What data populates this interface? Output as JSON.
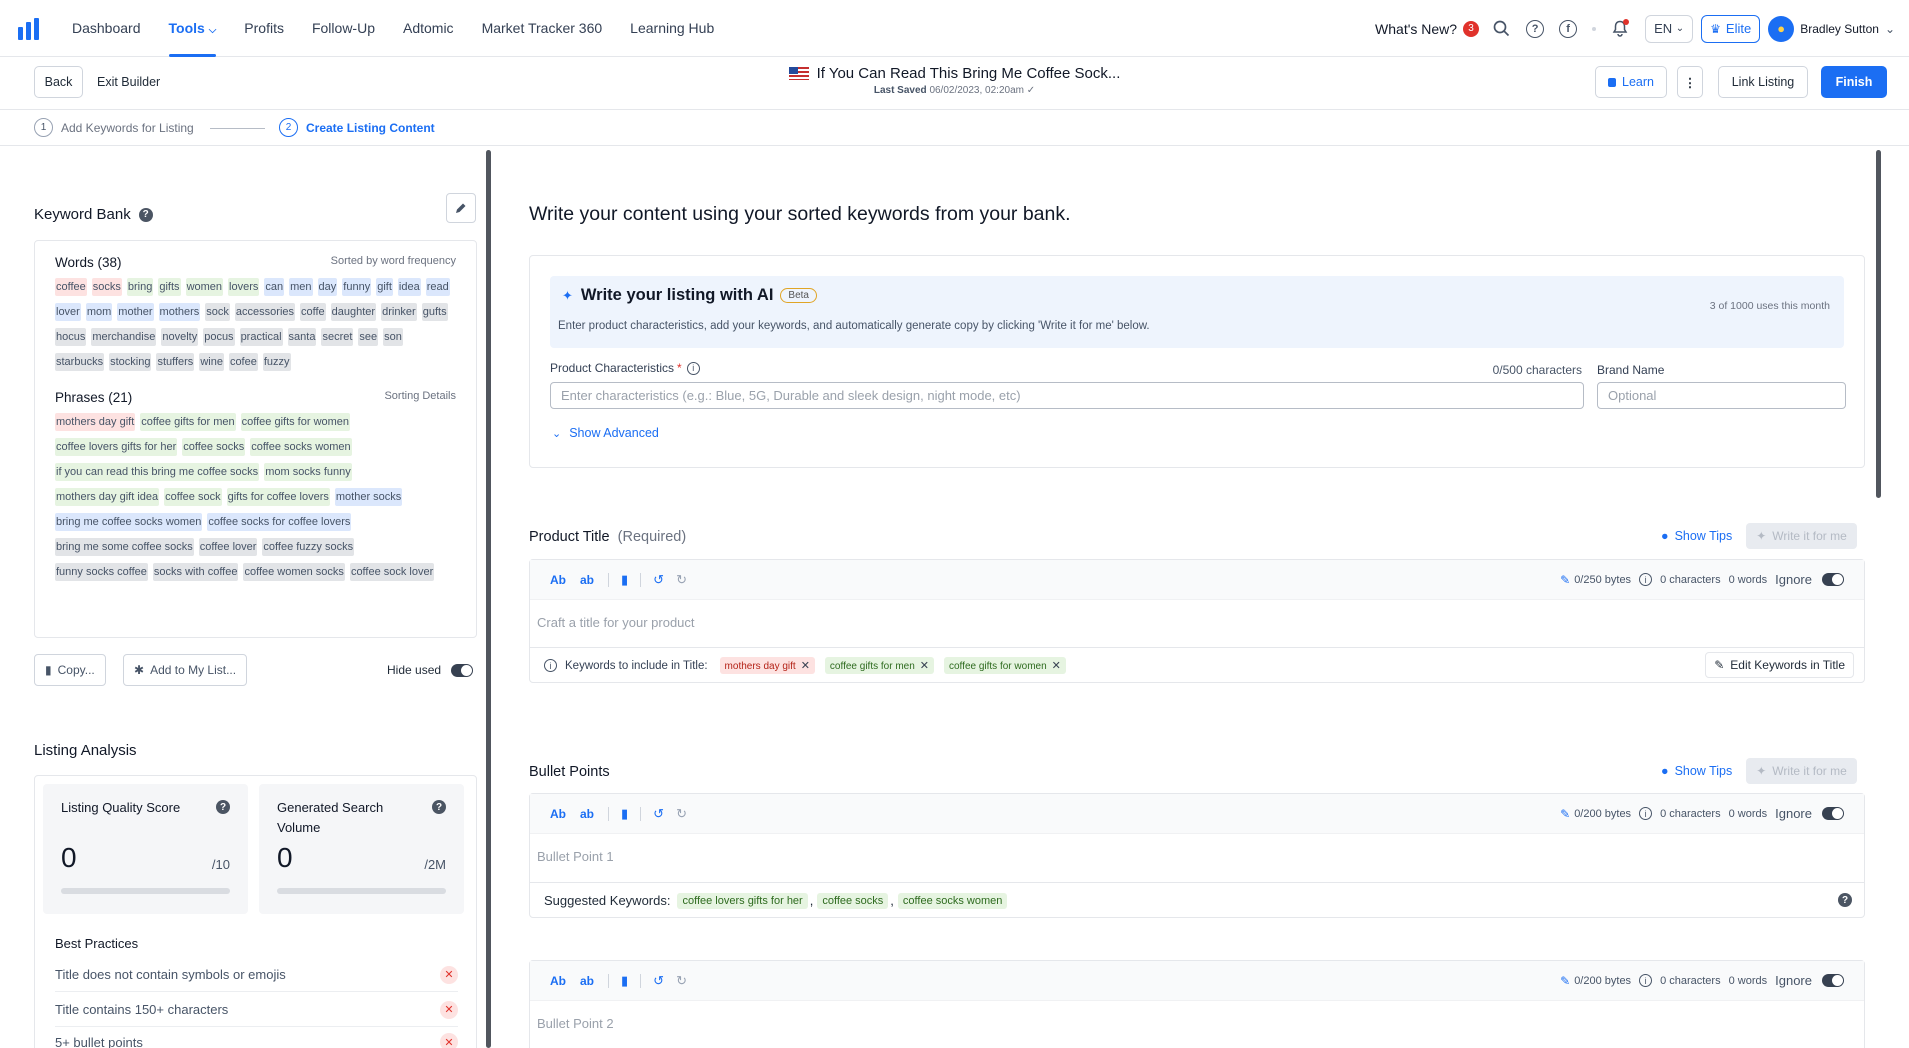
{
  "nav": {
    "items": [
      "Dashboard",
      "Tools",
      "Profits",
      "Follow-Up",
      "Adtomic",
      "Market Tracker 360",
      "Learning Hub"
    ],
    "active": "Tools",
    "whats_new": "What's New?",
    "whats_new_count": "3",
    "language": "EN",
    "plan": "Elite",
    "user": "Bradley Sutton"
  },
  "builder": {
    "back": "Back",
    "exit": "Exit Builder",
    "listing_title": "If You Can Read This Bring Me Coffee Sock...",
    "last_saved_label": "Last Saved",
    "last_saved_value": "06/02/2023, 02:20am",
    "learn": "Learn",
    "link_listing": "Link Listing",
    "finish": "Finish"
  },
  "steps": [
    {
      "num": "1",
      "label": "Add Keywords for Listing"
    },
    {
      "num": "2",
      "label": "Create Listing Content"
    }
  ],
  "keyword_bank": {
    "title": "Keyword Bank",
    "words_header": "Words (38)",
    "words_sort": "Sorted by word frequency",
    "words": [
      {
        "t": "coffee",
        "c": "red"
      },
      {
        "t": "socks",
        "c": "red"
      },
      {
        "t": "bring",
        "c": "green"
      },
      {
        "t": "gifts",
        "c": "green"
      },
      {
        "t": "women",
        "c": "green"
      },
      {
        "t": "lovers",
        "c": "green"
      },
      {
        "t": "can",
        "c": "blue"
      },
      {
        "t": "men",
        "c": "blue"
      },
      {
        "t": "day",
        "c": "blue"
      },
      {
        "t": "funny",
        "c": "blue"
      },
      {
        "t": "gift",
        "c": "blue"
      },
      {
        "t": "idea",
        "c": "blue"
      },
      {
        "t": "read",
        "c": "blue"
      },
      {
        "t": "lover",
        "c": "blue"
      },
      {
        "t": "mom",
        "c": "blue"
      },
      {
        "t": "mother",
        "c": "blue"
      },
      {
        "t": "mothers",
        "c": "blue"
      },
      {
        "t": "sock",
        "c": "gray"
      },
      {
        "t": "accessories",
        "c": "gray"
      },
      {
        "t": "coffe",
        "c": "gray"
      },
      {
        "t": "daughter",
        "c": "gray"
      },
      {
        "t": "drinker",
        "c": "gray"
      },
      {
        "t": "gufts",
        "c": "gray"
      },
      {
        "t": "hocus",
        "c": "gray"
      },
      {
        "t": "merchandise",
        "c": "gray"
      },
      {
        "t": "novelty",
        "c": "gray"
      },
      {
        "t": "pocus",
        "c": "gray"
      },
      {
        "t": "practical",
        "c": "gray"
      },
      {
        "t": "santa",
        "c": "gray"
      },
      {
        "t": "secret",
        "c": "gray"
      },
      {
        "t": "see",
        "c": "gray"
      },
      {
        "t": "son",
        "c": "gray"
      },
      {
        "t": "starbucks",
        "c": "gray"
      },
      {
        "t": "stocking",
        "c": "gray"
      },
      {
        "t": "stuffers",
        "c": "gray"
      },
      {
        "t": "wine",
        "c": "gray"
      },
      {
        "t": "cofee",
        "c": "gray"
      },
      {
        "t": "fuzzy",
        "c": "gray"
      }
    ],
    "phrases_header": "Phrases (21)",
    "phrases_sort": "Sorting Details",
    "phrases": [
      {
        "t": "mothers day gift",
        "c": "red"
      },
      {
        "t": "coffee gifts for men",
        "c": "green"
      },
      {
        "t": "coffee gifts for women",
        "c": "green"
      },
      {
        "t": "coffee lovers gifts for her",
        "c": "green"
      },
      {
        "t": "coffee socks",
        "c": "green"
      },
      {
        "t": "coffee socks women",
        "c": "green"
      },
      {
        "t": "if you can read this bring me coffee socks",
        "c": "green"
      },
      {
        "t": "mom socks funny",
        "c": "green"
      },
      {
        "t": "mothers day gift idea",
        "c": "green"
      },
      {
        "t": "coffee sock",
        "c": "green"
      },
      {
        "t": "gifts for coffee lovers",
        "c": "green"
      },
      {
        "t": "mother socks",
        "c": "blue"
      },
      {
        "t": "bring me coffee socks women",
        "c": "blue"
      },
      {
        "t": "coffee socks for coffee lovers",
        "c": "blue"
      },
      {
        "t": "bring me some coffee socks",
        "c": "gray"
      },
      {
        "t": "coffee lover",
        "c": "gray"
      },
      {
        "t": "coffee fuzzy socks",
        "c": "gray"
      },
      {
        "t": "funny socks coffee",
        "c": "gray"
      },
      {
        "t": "socks with coffee",
        "c": "gray"
      },
      {
        "t": "coffee women socks",
        "c": "gray"
      },
      {
        "t": "coffee sock lover",
        "c": "gray"
      }
    ],
    "copy": "Copy...",
    "add_to_list": "Add to My List...",
    "hide_used": "Hide used"
  },
  "analysis": {
    "title": "Listing Analysis",
    "quality_label": "Listing Quality Score",
    "quality_value": "0",
    "quality_max": "/10",
    "volume_label": "Generated Search Volume",
    "volume_value": "0",
    "volume_max": "/2M",
    "best_practices": "Best Practices",
    "practices": [
      "Title does not contain symbols or emojis",
      "Title contains 150+ characters",
      "5+ bullet points"
    ]
  },
  "main": {
    "heading": "Write your content using your sorted keywords from your bank.",
    "ai_title": "Write your listing with AI",
    "ai_badge": "Beta",
    "ai_desc": "Enter product characteristics, add your keywords, and automatically generate copy by clicking 'Write it for me' below.",
    "ai_usage": "3 of 1000 uses this month",
    "char_label": "Product Characteristics",
    "char_required": "*",
    "char_count": "0/500 characters",
    "char_placeholder": "Enter characteristics (e.g.: Blue, 5G, Durable and sleek design, night mode, etc)",
    "brand_label": "Brand Name",
    "brand_placeholder": "Optional",
    "show_advanced": "Show Advanced",
    "title_section": "Product Title",
    "title_required": "(Required)",
    "show_tips": "Show Tips",
    "write_for_me": "Write it for me",
    "tb_ab1": "Ab",
    "tb_ab2": "ab",
    "title_bytes": "0/250 bytes",
    "chars": "0 characters",
    "words": "0 words",
    "ignore": "Ignore",
    "title_placeholder": "Craft a title for your product",
    "kw_include_label": "Keywords to include in Title:",
    "kw_include": [
      {
        "t": "mothers day gift",
        "c": "r"
      },
      {
        "t": "coffee gifts for men",
        "c": "g"
      },
      {
        "t": "coffee gifts for women",
        "c": "g"
      }
    ],
    "edit_keywords": "Edit Keywords in Title",
    "bullet_section": "Bullet Points",
    "bullet_bytes": "0/200 bytes",
    "bullet1_placeholder": "Bullet Point 1",
    "bullet2_placeholder": "Bullet Point 2",
    "suggested_label": "Suggested Keywords:",
    "suggested": [
      "coffee lovers gifts for her",
      "coffee socks",
      "coffee socks women"
    ]
  },
  "colors": {
    "accent": "#1b6ef3",
    "red_chip": "#fde2e1",
    "green_chip": "#e6f4e1",
    "blue_chip": "#dbe7fc",
    "gray_chip": "#e2e4e7"
  }
}
